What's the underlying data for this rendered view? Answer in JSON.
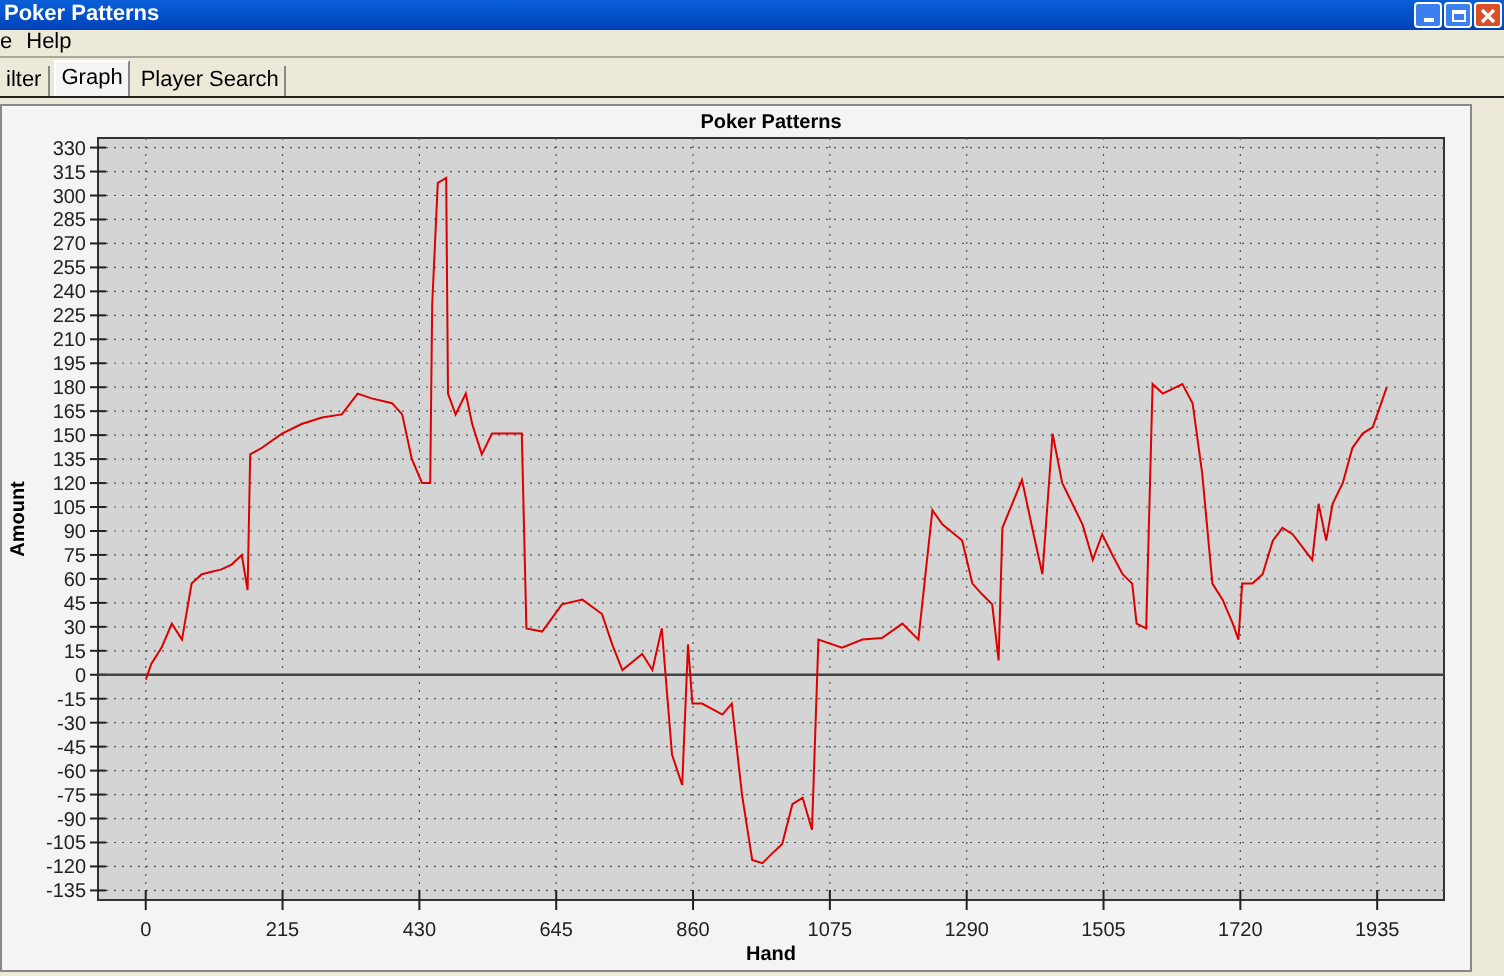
{
  "window": {
    "title": "Poker Patterns"
  },
  "menu": [
    "e",
    "Help"
  ],
  "tabs": [
    {
      "label": "ilter",
      "selected": false
    },
    {
      "label": "Graph",
      "selected": true
    },
    {
      "label": "Player Search",
      "selected": false
    }
  ],
  "chart_data": {
    "type": "line",
    "title": "Poker Patterns",
    "xlabel": "Hand",
    "ylabel": "Amount",
    "x": [
      0,
      9,
      25,
      41,
      57,
      72,
      88,
      119,
      135,
      151,
      160,
      164,
      182,
      214,
      245,
      277,
      308,
      333,
      355,
      387,
      403,
      418,
      434,
      447,
      450,
      459,
      472,
      475,
      487,
      503,
      513,
      528,
      544,
      576,
      591,
      598,
      623,
      654,
      686,
      717,
      733,
      749,
      780,
      796,
      811,
      827,
      843,
      852,
      859,
      874,
      906,
      921,
      937,
      953,
      969,
      984,
      1000,
      1016,
      1032,
      1047,
      1057,
      1079,
      1094,
      1126,
      1157,
      1189,
      1214,
      1236,
      1252,
      1283,
      1299,
      1315,
      1330,
      1340,
      1346,
      1377,
      1393,
      1409,
      1425,
      1440,
      1456,
      1472,
      1488,
      1503,
      1519,
      1535,
      1550,
      1557,
      1572,
      1582,
      1598,
      1629,
      1645,
      1660,
      1676,
      1692,
      1708,
      1717,
      1723,
      1739,
      1755,
      1771,
      1786,
      1802,
      1833,
      1843,
      1855,
      1865,
      1881,
      1896,
      1912,
      1928,
      1950
    ],
    "grid": true,
    "series": [
      {
        "color": "#dd0000",
        "values": [
          -3,
          7,
          17,
          32,
          22,
          57,
          63,
          66,
          69,
          75,
          53,
          138,
          142,
          151,
          157,
          161,
          163,
          176,
          173,
          170,
          163,
          135,
          120,
          120,
          232,
          308,
          311,
          176,
          163,
          176,
          157,
          138,
          151,
          151,
          151,
          29,
          27,
          44,
          47,
          38,
          19,
          3,
          13,
          3,
          29,
          -50,
          -69,
          19,
          -18,
          -18,
          -25,
          -18,
          -75,
          -116,
          -118,
          -112,
          -106,
          -81,
          -77,
          -97,
          22,
          19,
          17,
          22,
          23,
          32,
          22,
          103,
          94,
          84,
          57,
          50,
          44,
          9,
          92,
          122,
          92,
          63,
          151,
          120,
          107,
          94,
          72,
          88,
          75,
          63,
          57,
          32,
          29,
          182,
          176,
          182,
          170,
          126,
          57,
          47,
          32,
          22,
          57,
          57,
          63,
          84,
          92,
          88,
          72,
          107,
          84,
          107,
          120,
          142,
          151,
          155,
          180
        ]
      }
    ],
    "xlim": [
      -75,
      2040
    ],
    "ylim": [
      -141,
      336
    ],
    "xticks": [
      0,
      215,
      430,
      645,
      860,
      1075,
      1290,
      1505,
      1720,
      1935
    ],
    "yticks": [
      -135,
      -120,
      -105,
      -90,
      -75,
      -60,
      -45,
      -30,
      -15,
      0,
      15,
      30,
      45,
      60,
      75,
      90,
      105,
      120,
      135,
      150,
      165,
      180,
      195,
      210,
      225,
      240,
      255,
      270,
      285,
      300,
      315,
      330
    ]
  }
}
